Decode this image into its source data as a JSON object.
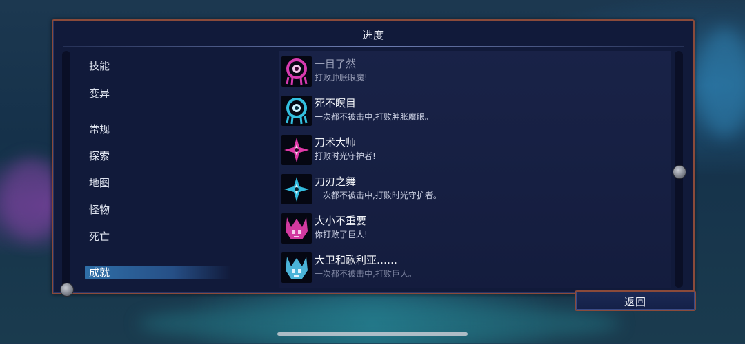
{
  "panel": {
    "title": "进度"
  },
  "categories": [
    {
      "label": "技能",
      "selected": false
    },
    {
      "label": "变异",
      "selected": false
    },
    {
      "label": "常规",
      "selected": false
    },
    {
      "label": "探索",
      "selected": false
    },
    {
      "label": "地图",
      "selected": false
    },
    {
      "label": "怪物",
      "selected": false
    },
    {
      "label": "死亡",
      "selected": false
    },
    {
      "label": "成就",
      "selected": true
    }
  ],
  "achievements": [
    {
      "title": "一目了然",
      "description": "打败肿胀眼魔!",
      "icon": "eye-monster-icon",
      "color": "#d83ab0"
    },
    {
      "title": "死不瞑目",
      "description": "一次都不被击中,打败肿胀魔眼。",
      "icon": "eye-monster-icon",
      "color": "#33c0e0"
    },
    {
      "title": "刀术大师",
      "description": "打败时光守护者!",
      "icon": "shuriken-icon",
      "color": "#e03aa8"
    },
    {
      "title": "刀刃之舞",
      "description": "一次都不被击中,打败时光守护者。",
      "icon": "shuriken-icon",
      "color": "#34bde0"
    },
    {
      "title": "大小不重要",
      "description": "你打败了巨人!",
      "icon": "giant-skull-icon",
      "color": "#d23aa0"
    },
    {
      "title": "大卫和歌利亚……",
      "description": "一次都不被击中,打败巨人。",
      "icon": "giant-skull-icon",
      "color": "#4ab3d8"
    }
  ],
  "buttons": {
    "back_label": "返回"
  },
  "colors": {
    "panel_border": "#8a4a3a",
    "panel_bg": "#111a3a",
    "selected_bg": "#2f6fa8"
  }
}
